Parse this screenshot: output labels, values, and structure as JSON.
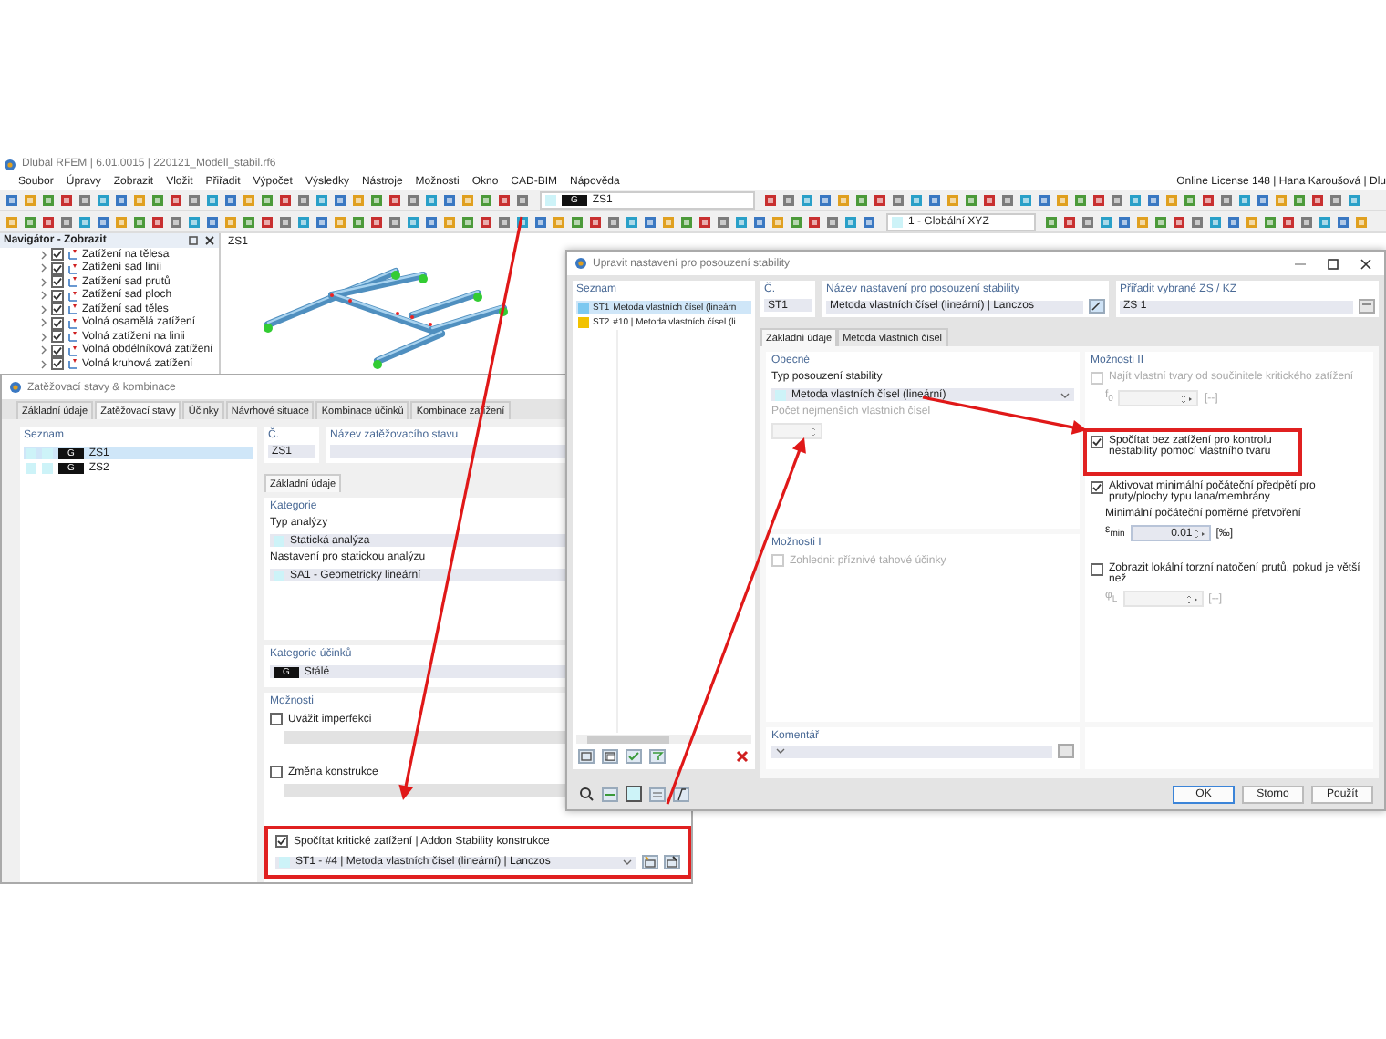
{
  "app": {
    "title": "Dlubal RFEM | 6.01.0015 | 220121_Modell_stabil.rf6",
    "menu": [
      "Soubor",
      "Úpravy",
      "Zobrazit",
      "Vložit",
      "Přiřadit",
      "Výpočet",
      "Výsledky",
      "Nástroje",
      "Možnosti",
      "Okno",
      "CAD-BIM",
      "Nápověda"
    ],
    "license": "Online License 148 | Hana Karoušová | Dlu",
    "load_case_combo": {
      "badge": "G",
      "value": "ZS1"
    },
    "coord_combo": {
      "value": "1 - Globální XYZ"
    }
  },
  "navigator": {
    "title": "Navigátor - Zobrazit",
    "items": [
      {
        "label": "Zatížení na tělesa",
        "checked": true
      },
      {
        "label": "Zatížení sad linií",
        "checked": true
      },
      {
        "label": "Zatížení sad prutů",
        "checked": true
      },
      {
        "label": "Zatížení sad ploch",
        "checked": true
      },
      {
        "label": "Zatížení sad těles",
        "checked": true
      },
      {
        "label": "Volná osamělá zatížení",
        "checked": true
      },
      {
        "label": "Volná zatížení na linii",
        "checked": true
      },
      {
        "label": "Volná obdélníková zatížení",
        "checked": true
      },
      {
        "label": "Volná kruhová zatížení",
        "checked": true
      }
    ]
  },
  "viewport": {
    "label": "ZS1"
  },
  "load_cases_dialog": {
    "title": "Zatěžovací stavy & kombinace",
    "tabs": [
      {
        "label": "Základní údaje",
        "selected": false
      },
      {
        "label": "Zatěžovací stavy",
        "selected": true
      },
      {
        "label": "Účinky",
        "selected": false
      },
      {
        "label": "Návrhové situace",
        "selected": false
      },
      {
        "label": "Kombinace účinků",
        "selected": false
      },
      {
        "label": "Kombinace zatížení",
        "selected": false
      }
    ],
    "list_title": "Seznam",
    "rows": [
      {
        "badge": "G",
        "label": "ZS1",
        "selected": true
      },
      {
        "badge": "G",
        "label": "ZS2",
        "selected": false
      }
    ],
    "number_label": "Č.",
    "number": "ZS1",
    "name_label": "Název zatěžovacího stavu",
    "subtab": "Základní údaje",
    "category": {
      "title": "Kategorie",
      "analysis_label": "Typ analýzy",
      "analysis": "Statická analýza",
      "settings_label": "Nastavení pro statickou analýzu",
      "settings": "SA1 - Geometricky lineární"
    },
    "action_category": {
      "title": "Kategorie účinků",
      "badge": "G",
      "value": "Stálé"
    },
    "options": {
      "title": "Možnosti",
      "items": [
        {
          "label": "Uvážit imperfekci",
          "checked": false,
          "highlighted": false
        },
        {
          "label": "Změna konstrukce",
          "checked": false,
          "highlighted": false
        },
        {
          "label": "Spočítat kritické zatížení | Addon Stability konstrukce",
          "checked": true,
          "highlighted": true,
          "value": "ST1 - #4 | Metoda vlastních čísel (lineární) | Lanczos"
        }
      ]
    }
  },
  "stability_dialog": {
    "title": "Upravit nastavení pro posouzení stability",
    "list_title": "Seznam",
    "rows": [
      {
        "id": "ST1",
        "label": "Metoda vlastních čísel (lineárn",
        "color": "#7cc8f0",
        "selected": true
      },
      {
        "id": "ST2",
        "label": "#10 | Metoda vlastních čísel (li",
        "color": "#f2c200",
        "selected": false
      }
    ],
    "number_label": "Č.",
    "number": "ST1",
    "name_label": "Název nastavení pro posouzení stability",
    "name": "Metoda vlastních čísel (lineární) | Lanczos",
    "assign_label": "Přiřadit vybrané ZS / KZ",
    "assign": "ZS 1",
    "tabs": [
      {
        "label": "Základní údaje",
        "selected": true
      },
      {
        "label": "Metoda vlastních čísel",
        "selected": false
      }
    ],
    "general": {
      "title": "Obecné",
      "type_label": "Typ posouzení stability",
      "type": "Metoda vlastních čísel (lineární)",
      "count_label": "Počet nejmenších vlastních čísel",
      "count_disabled": true
    },
    "options1": {
      "title": "Možnosti I",
      "items": [
        {
          "label": "Zohlednit příznivé tahové účinky",
          "checked": false,
          "disabled": true
        }
      ]
    },
    "options2": {
      "title": "Možnosti II",
      "items": [
        {
          "label": "Najít vlastní tvary od součinitele kritického zatížení",
          "checked": false,
          "disabled": true,
          "highlighted": false,
          "spin": {
            "symbol": "f$_{0}$",
            "unit": "[--]",
            "disabled": true
          }
        },
        {
          "label": "Spočítat bez zatížení pro kontrolu nestability pomocí vlastního tvaru",
          "checked": true,
          "disabled": false,
          "highlighted": true
        },
        {
          "label": "Aktivovat minimální počáteční předpětí pro pruty/plochy typu lana/membrány",
          "checked": true,
          "disabled": false,
          "highlighted": false,
          "note": "Minimální počáteční poměrné přetvoření",
          "spin": {
            "symbol": "ε$_{min}$",
            "value": "0.01",
            "unit": "[‰]",
            "disabled": false
          }
        },
        {
          "label": "Zobrazit lokální torzní natočení prutů, pokud je větší než",
          "checked": false,
          "disabled": false,
          "highlighted": false,
          "spin": {
            "symbol": "φ$_{L}$",
            "unit": "[--]",
            "disabled": true
          }
        }
      ]
    },
    "comment_label": "Komentář",
    "buttons": [
      "OK",
      "Storno",
      "Použít"
    ]
  }
}
